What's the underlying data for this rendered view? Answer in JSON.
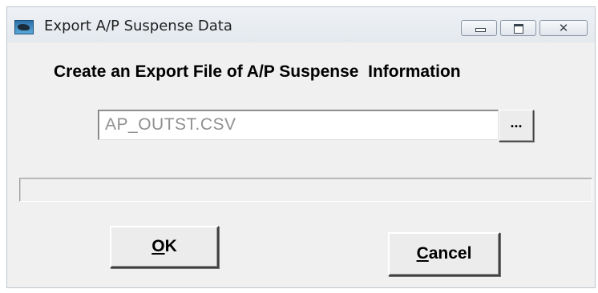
{
  "window": {
    "title": "Export A/P Suspense Data",
    "icon": "app-icon"
  },
  "caption_buttons": {
    "minimize_icon": "minimize-icon",
    "maximize_icon": "maximize-icon",
    "close_icon": "close-icon",
    "close_glyph": "✕"
  },
  "heading": "Create an Export File of A/P Suspense  Information",
  "file": {
    "value": "AP_OUTST.CSV",
    "browse_label": "..."
  },
  "progress": {
    "fraction": 0
  },
  "buttons": {
    "ok_mnemonic": "O",
    "ok_rest": "K",
    "cancel_mnemonic": "C",
    "cancel_rest": "ancel"
  },
  "colors": {
    "window_bg": "#f0f0f0",
    "input_text": "#909090",
    "progress_fill": "#3b6fd4"
  }
}
